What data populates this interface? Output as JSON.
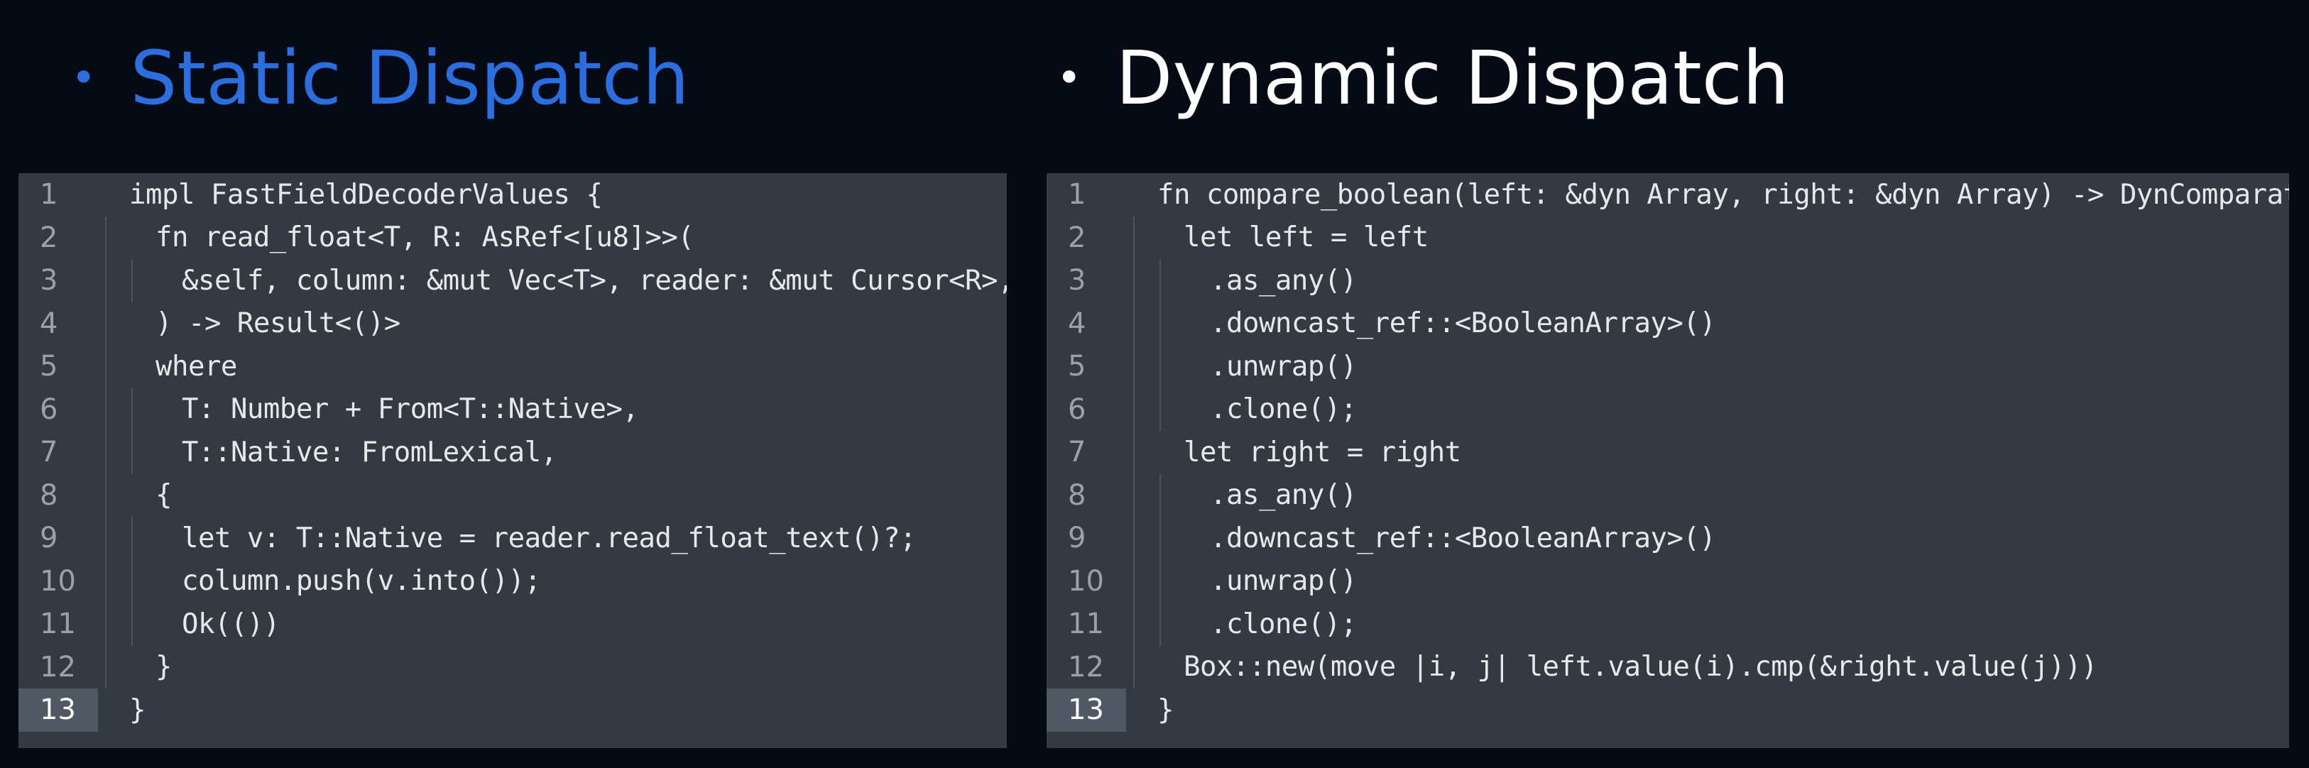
{
  "headings": {
    "static": "Static Dispatch",
    "dynamic": "Dynamic Dispatch",
    "bullet": "•"
  },
  "colors": {
    "background": "#060a14",
    "panel": "#343a42",
    "static_heading": "#2a6ee0",
    "dynamic_heading": "#ffffff",
    "code_text": "#e6e8ea",
    "line_number": "#9aa1a9",
    "current_line_gutter": "#4e5963"
  },
  "static_code": {
    "current_line": 13,
    "lines": [
      {
        "num": "1",
        "indent": 0,
        "text": "impl FastFieldDecoderValues {"
      },
      {
        "num": "2",
        "indent": 1,
        "text": "fn read_float<T, R: AsRef<[u8]>>("
      },
      {
        "num": "3",
        "indent": 2,
        "text": "&self, column: &mut Vec<T>, reader: &mut Cursor<R>,"
      },
      {
        "num": "4",
        "indent": 1,
        "text": ") -> Result<()>"
      },
      {
        "num": "5",
        "indent": 1,
        "text": "where"
      },
      {
        "num": "6",
        "indent": 2,
        "text": "T: Number + From<T::Native>,"
      },
      {
        "num": "7",
        "indent": 2,
        "text": "T::Native: FromLexical,"
      },
      {
        "num": "8",
        "indent": 1,
        "text": "{"
      },
      {
        "num": "9",
        "indent": 2,
        "text": "let v: T::Native = reader.read_float_text()?;"
      },
      {
        "num": "10",
        "indent": 2,
        "text": "column.push(v.into());"
      },
      {
        "num": "11",
        "indent": 2,
        "text": "Ok(())"
      },
      {
        "num": "12",
        "indent": 1,
        "text": "}"
      },
      {
        "num": "13",
        "indent": 0,
        "text": "}"
      }
    ]
  },
  "dynamic_code": {
    "current_line": 13,
    "lines": [
      {
        "num": "1",
        "indent": 0,
        "text": "fn compare_boolean(left: &dyn Array, right: &dyn Array) -> DynComparator {"
      },
      {
        "num": "2",
        "indent": 1,
        "text": "let left = left"
      },
      {
        "num": "3",
        "indent": 2,
        "text": ".as_any()"
      },
      {
        "num": "4",
        "indent": 2,
        "text": ".downcast_ref::<BooleanArray>()"
      },
      {
        "num": "5",
        "indent": 2,
        "text": ".unwrap()"
      },
      {
        "num": "6",
        "indent": 2,
        "text": ".clone();"
      },
      {
        "num": "7",
        "indent": 1,
        "text": "let right = right"
      },
      {
        "num": "8",
        "indent": 2,
        "text": ".as_any()"
      },
      {
        "num": "9",
        "indent": 2,
        "text": ".downcast_ref::<BooleanArray>()"
      },
      {
        "num": "10",
        "indent": 2,
        "text": ".unwrap()"
      },
      {
        "num": "11",
        "indent": 2,
        "text": ".clone();"
      },
      {
        "num": "12",
        "indent": 1,
        "text": "Box::new(move |i, j| left.value(i).cmp(&right.value(j)))"
      },
      {
        "num": "13",
        "indent": 0,
        "text": "}"
      }
    ]
  }
}
